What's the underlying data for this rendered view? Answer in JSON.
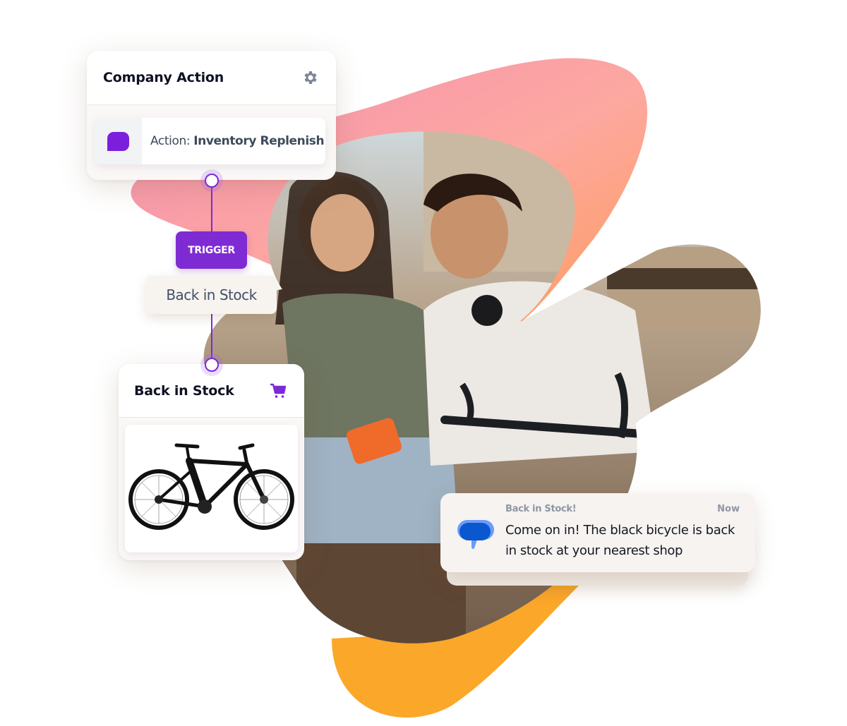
{
  "company_card": {
    "title": "Company Action",
    "settings_icon": "gear-icon",
    "action_prefix": "Action: ",
    "action_value": "Inventory Replenish",
    "action_icon": "message-bubble-icon"
  },
  "trigger": {
    "badge_label": "TRIGGER",
    "event_label": "Back in Stock"
  },
  "stock_card": {
    "title": "Back in Stock",
    "cart_icon": "shopping-cart-icon",
    "product_image": "black-bicycle"
  },
  "notification": {
    "app_icon": "messages-icon",
    "app_name": "Back in Stock!",
    "time": "Now",
    "message": "Come on in! The black bicycle is back in stock at your nearest shop"
  },
  "colors": {
    "brand_purple": "#7f2bd4",
    "blob_pink": "#f59aae",
    "blob_orange": "#fda65a",
    "blob_amber": "#fba72a",
    "notif_blue": "#0b57d0"
  }
}
